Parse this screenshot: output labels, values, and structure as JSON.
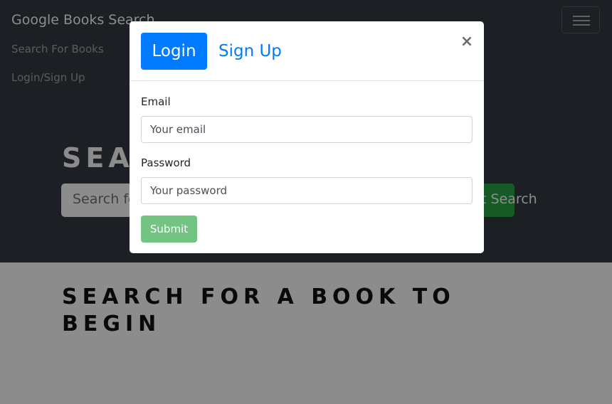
{
  "navbar": {
    "brand": "Google Books Search",
    "links": [
      "Search For Books",
      "Login/Sign Up"
    ],
    "toggler_icon": "hamburger-icon"
  },
  "hero": {
    "title": "Search for Books!",
    "search_placeholder": "Search for a book",
    "submit_label": "Submit Search"
  },
  "results": {
    "message": "Search for a book to begin"
  },
  "modal": {
    "tabs": {
      "login": "Login",
      "signup": "Sign Up"
    },
    "close_label": "×",
    "close_icon": "close-icon",
    "email_label": "Email",
    "email_placeholder": "Your email",
    "password_label": "Password",
    "password_placeholder": "Your password",
    "submit_label": "Submit"
  },
  "colors": {
    "navbar_bg": "#343a40",
    "primary": "#007bff",
    "success": "#28a745",
    "submit_disabled": "#73c383"
  }
}
